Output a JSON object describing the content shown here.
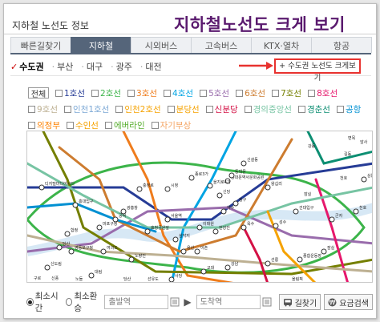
{
  "header": {
    "app_title": "지하철 노선도 정보",
    "promo_title": "지하철노선도 크게 보기"
  },
  "tabs": [
    {
      "label": "빠른길찾기"
    },
    {
      "label": "지하철"
    },
    {
      "label": "시외버스"
    },
    {
      "label": "고속버스"
    },
    {
      "label": "KTX·열차"
    },
    {
      "label": "항공"
    }
  ],
  "regions": [
    {
      "label": "수도권"
    },
    {
      "label": "부산"
    },
    {
      "label": "대구"
    },
    {
      "label": "광주"
    },
    {
      "label": "대전"
    }
  ],
  "big_view_button": "+ 수도권 노선도 크게보기",
  "line_filter": {
    "all_label": "전체",
    "lines": [
      {
        "label": "1호선",
        "color": "#263c96"
      },
      {
        "label": "2호선",
        "color": "#3cb44a"
      },
      {
        "label": "3호선",
        "color": "#ef7c1c"
      },
      {
        "label": "4호선",
        "color": "#00a4e3"
      },
      {
        "label": "5호선",
        "color": "#996cac"
      },
      {
        "label": "6호선",
        "color": "#cd7c2f"
      },
      {
        "label": "7호선",
        "color": "#747f00"
      },
      {
        "label": "8호선",
        "color": "#e6186c"
      },
      {
        "label": "9호선",
        "color": "#bdb092"
      },
      {
        "label": "인천1호선",
        "color": "#7ca8d5"
      },
      {
        "label": "인천2호선",
        "color": "#f5a200"
      },
      {
        "label": "분당선",
        "color": "#f5a200"
      },
      {
        "label": "신분당",
        "color": "#d31145"
      },
      {
        "label": "경의중앙선",
        "color": "#77c4a3"
      },
      {
        "label": "경춘선",
        "color": "#0c8e72"
      },
      {
        "label": "공항",
        "color": "#0090d2"
      },
      {
        "label": "의정부",
        "color": "#fd8100"
      },
      {
        "label": "수인선",
        "color": "#f5a200"
      },
      {
        "label": "에버라인",
        "color": "#56ad2d"
      },
      {
        "label": "자기부상",
        "color": "#f4a462"
      }
    ]
  },
  "map": {
    "stations": [
      "디지털미디어시티",
      "홍대입구",
      "공덕",
      "합정",
      "충정로",
      "시청",
      "종로3가",
      "동대문역사문화공원",
      "을지로4가",
      "왕십리",
      "신설동",
      "건대입구",
      "군자",
      "서울역",
      "삼각지",
      "용산",
      "이촌",
      "옥수",
      "노량진",
      "여의도",
      "영등포구청",
      "신도림",
      "대림",
      "당산",
      "성수",
      "상봉",
      "종합운동장",
      "선릉",
      "강남",
      "교대",
      "사당",
      "잠실",
      "천호",
      "신당",
      "동대문",
      "약수",
      "효창공원앞",
      "마포구청",
      "광흥창",
      "이태원",
      "한강진",
      "청구"
    ],
    "station_letter_labels": [
      "구로",
      "신풍",
      "노들",
      "당산",
      "선유도",
      "올림픽",
      "강동",
      "길동",
      "암사",
      "면목",
      "천호",
      "잠실"
    ]
  },
  "search": {
    "radio_options": [
      "최소시간",
      "최소환승"
    ],
    "selected_option": "최소시간",
    "departure_placeholder": "출발역",
    "arrival_placeholder": "도착역",
    "route_button": "길찾기",
    "fare_button": "요금검색",
    "swap_symbol": "▶"
  }
}
